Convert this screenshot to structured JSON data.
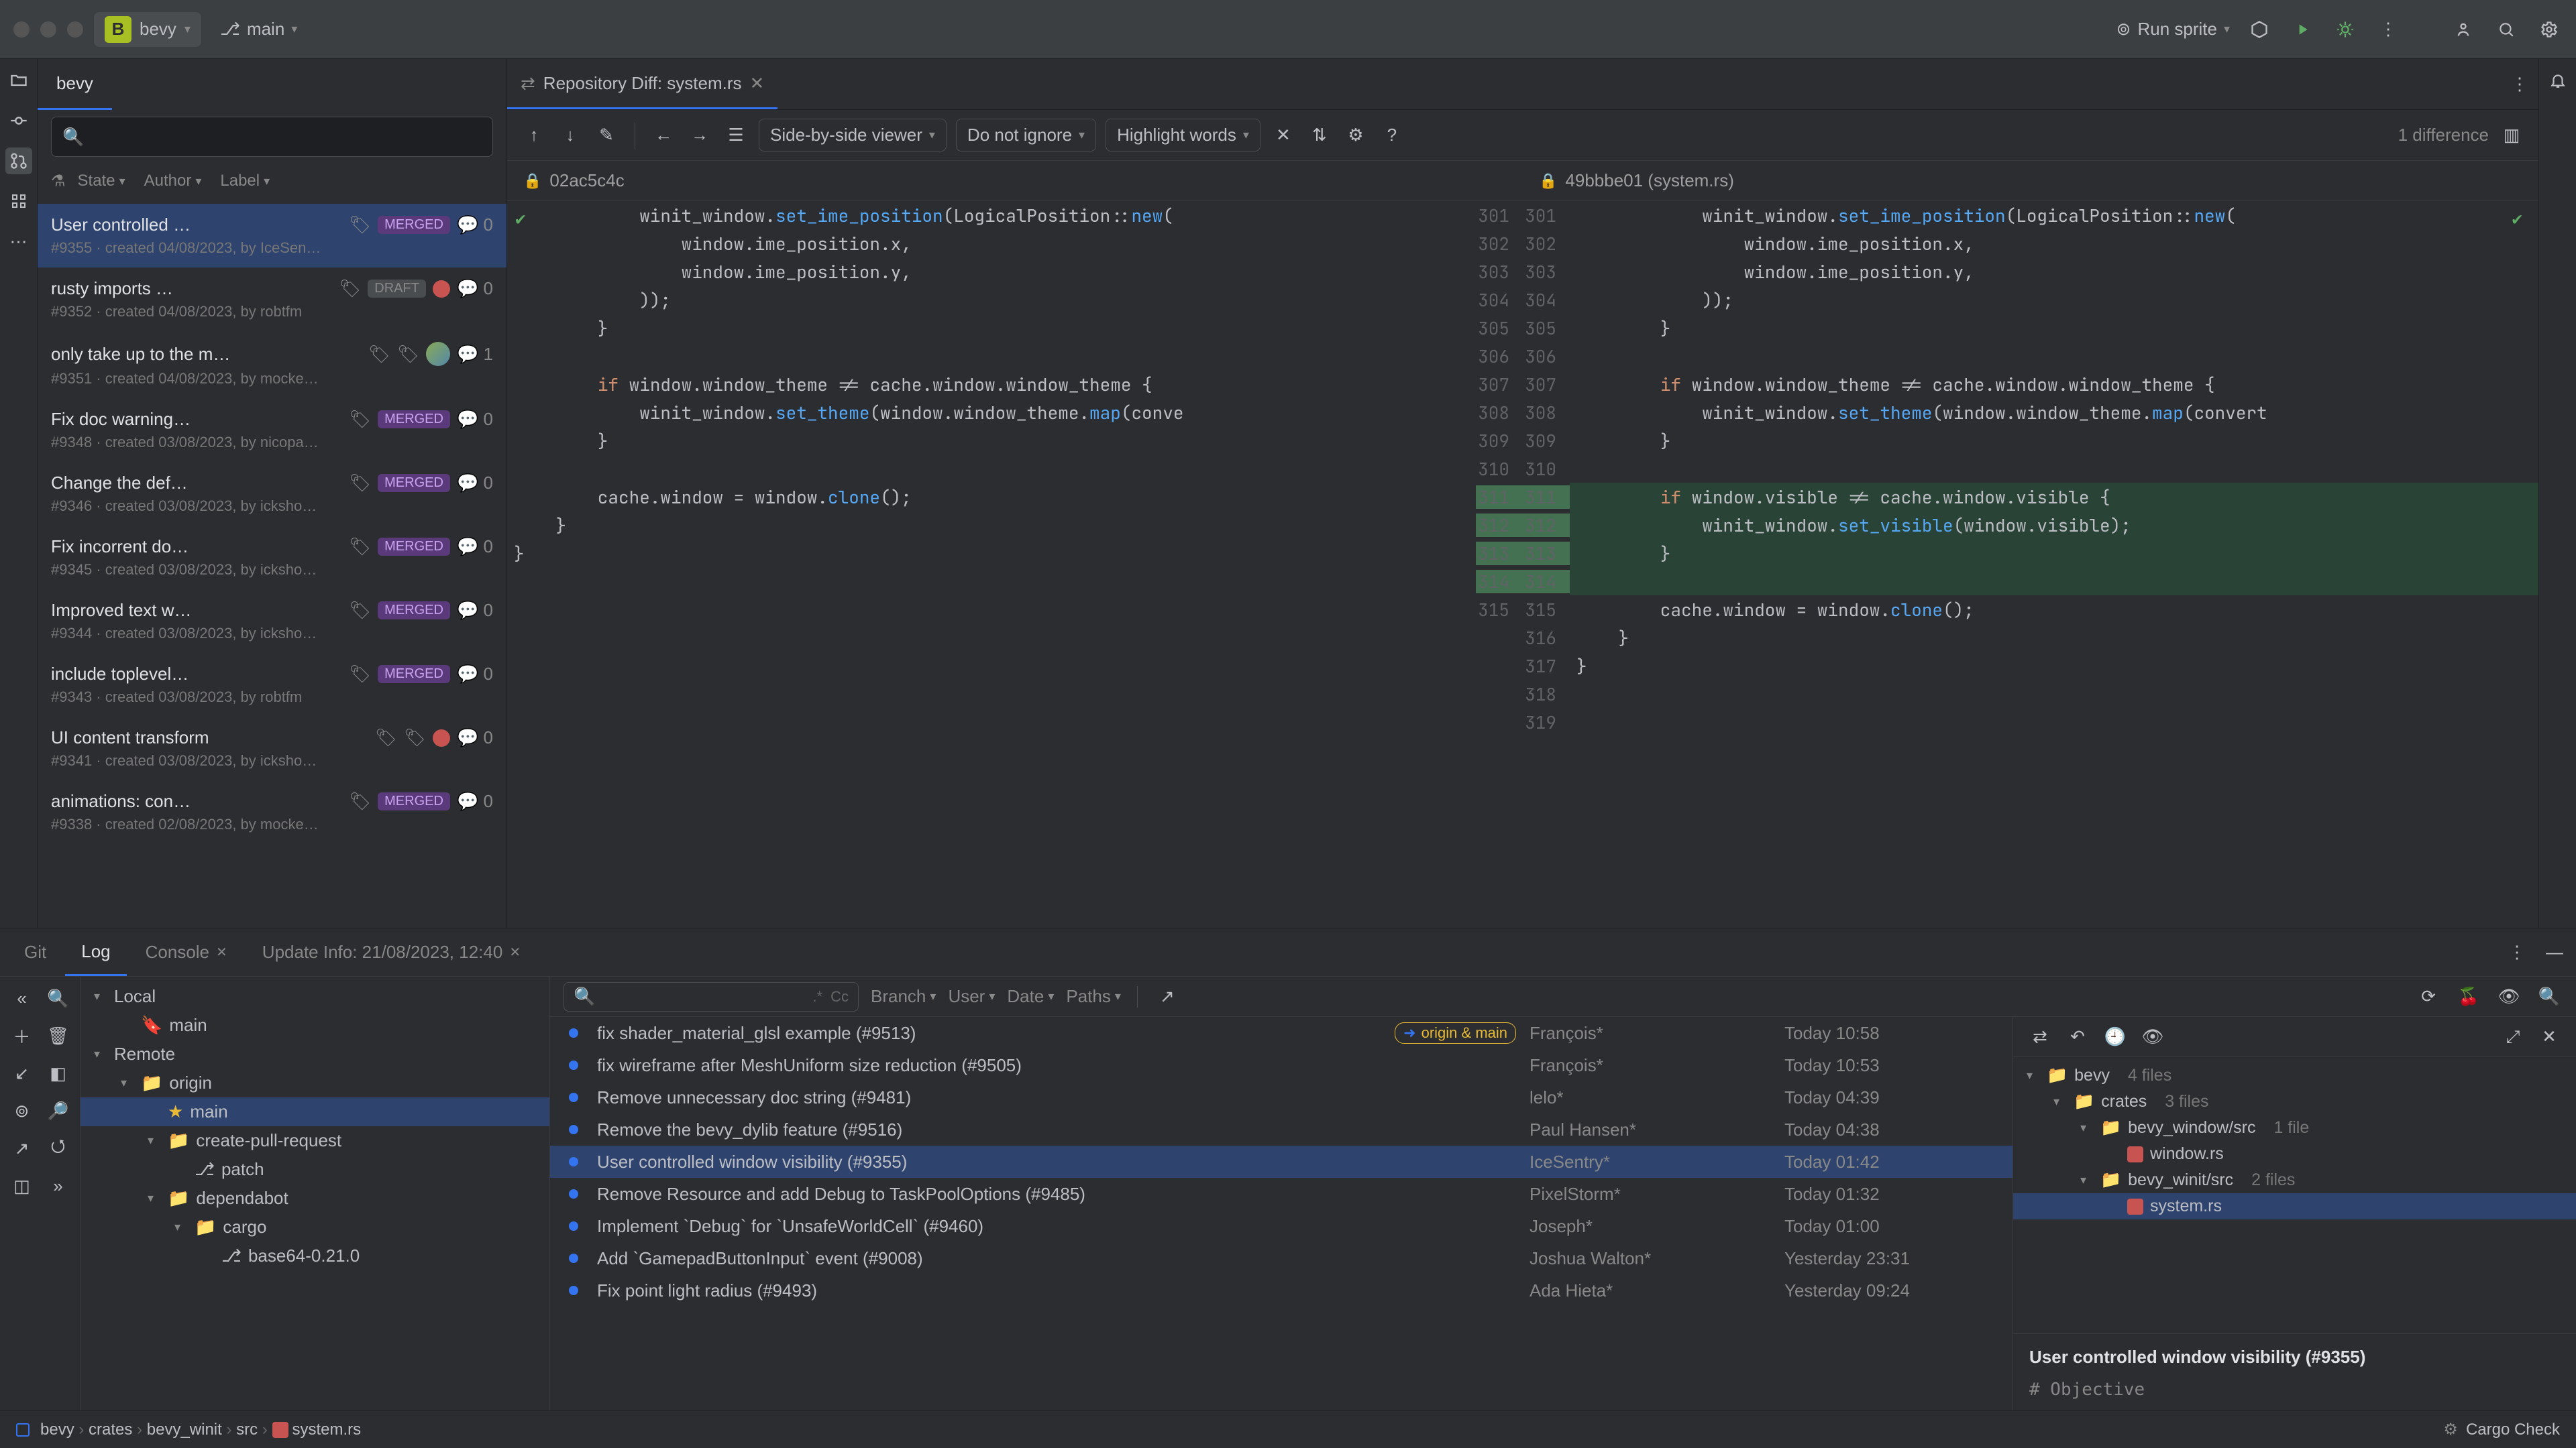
{
  "titlebar": {
    "project_letter": "B",
    "project": "bevy",
    "branch": "main",
    "run_config": "Run sprite"
  },
  "pr_panel": {
    "tab": "bevy",
    "filters": {
      "state": "State",
      "author": "Author",
      "label": "Label"
    },
    "items": [
      {
        "title": "User controlled …",
        "badge": "MERGED",
        "comments": "0",
        "meta": "#9355 · created 04/08/2023, by IceSen…",
        "draft": false,
        "fail": false,
        "avatar": false,
        "sel": true
      },
      {
        "title": "rusty imports …",
        "badge": "DRAFT",
        "comments": "0",
        "meta": "#9352 · created 04/08/2023, by robtfm",
        "draft": true,
        "fail": true,
        "avatar": false
      },
      {
        "title": "only take up to the m…",
        "badge": "",
        "comments": "1",
        "meta": "#9351 · created 04/08/2023, by mocke…",
        "draft": false,
        "fail": false,
        "avatar": true
      },
      {
        "title": "Fix doc warning…",
        "badge": "MERGED",
        "comments": "0",
        "meta": "#9348 · created 03/08/2023, by nicopa…",
        "draft": false,
        "fail": false,
        "avatar": false
      },
      {
        "title": "Change the def…",
        "badge": "MERGED",
        "comments": "0",
        "meta": "#9346 · created 03/08/2023, by icksho…",
        "draft": false,
        "fail": false,
        "avatar": false
      },
      {
        "title": "Fix incorrent do…",
        "badge": "MERGED",
        "comments": "0",
        "meta": "#9345 · created 03/08/2023, by icksho…",
        "draft": false,
        "fail": false,
        "avatar": false
      },
      {
        "title": "Improved text w…",
        "badge": "MERGED",
        "comments": "0",
        "meta": "#9344 · created 03/08/2023, by icksho…",
        "draft": false,
        "fail": false,
        "avatar": false
      },
      {
        "title": "include toplevel…",
        "badge": "MERGED",
        "comments": "0",
        "meta": "#9343 · created 03/08/2023, by robtfm",
        "draft": false,
        "fail": false,
        "avatar": false
      },
      {
        "title": "UI content transform",
        "badge": "",
        "comments": "0",
        "meta": "#9341 · created 03/08/2023, by icksho…",
        "draft": false,
        "fail": true,
        "avatar": false
      },
      {
        "title": "animations: con…",
        "badge": "MERGED",
        "comments": "0",
        "meta": "#9338 · created 02/08/2023, by mocke…",
        "draft": false,
        "fail": false,
        "avatar": false
      }
    ]
  },
  "editor": {
    "tab_label": "Repository Diff: system.rs",
    "diff_toolbar": {
      "viewer_mode": "Side-by-side viewer",
      "whitespace": "Do not ignore",
      "highlight": "Highlight words",
      "summary": "1 difference"
    },
    "left_rev": "02ac5c4c",
    "right_rev": "49bbbe01 (system.rs)",
    "left_lines": [
      {
        "n": "",
        "text": "            winit_window.set_ime_position(LogicalPosition::new("
      },
      {
        "n": "",
        "text": "                window.ime_position.x,"
      },
      {
        "n": "",
        "text": "                window.ime_position.y,"
      },
      {
        "n": "",
        "text": "            ));"
      },
      {
        "n": "",
        "text": "        }"
      },
      {
        "n": "",
        "text": ""
      },
      {
        "n": "",
        "text": "        if window.window_theme != cache.window.window_theme {"
      },
      {
        "n": "",
        "text": "            winit_window.set_theme(window.window_theme.map(conve"
      },
      {
        "n": "",
        "text": "        }"
      },
      {
        "n": "",
        "text": ""
      },
      {
        "n": "",
        "text": "        cache.window = window.clone();"
      },
      {
        "n": "",
        "text": "    }"
      },
      {
        "n": "",
        "text": "}"
      },
      {
        "n": "",
        "text": ""
      },
      {
        "n": "",
        "text": ""
      }
    ],
    "left_nums": [
      "",
      "",
      "",
      "",
      "",
      "",
      "",
      "",
      "",
      "",
      "",
      "",
      "",
      "",
      ""
    ],
    "gutter_left": [
      "301",
      "302",
      "303",
      "304",
      "305",
      "306",
      "307",
      "308",
      "309",
      "310",
      "311",
      "312",
      "313",
      "314",
      "315"
    ],
    "gutter_right": [
      "301",
      "302",
      "303",
      "304",
      "305",
      "306",
      "307",
      "308",
      "309",
      "310",
      "311",
      "312",
      "313",
      "314",
      "315",
      "316",
      "317",
      "318",
      "319"
    ],
    "right_lines": [
      {
        "n": "301",
        "text": "            winit_window.set_ime_position(LogicalPosition::new(",
        "add": false
      },
      {
        "n": "302",
        "text": "                window.ime_position.x,",
        "add": false
      },
      {
        "n": "303",
        "text": "                window.ime_position.y,",
        "add": false
      },
      {
        "n": "304",
        "text": "            ));",
        "add": false
      },
      {
        "n": "305",
        "text": "        }",
        "add": false
      },
      {
        "n": "306",
        "text": "",
        "add": false
      },
      {
        "n": "307",
        "text": "        if window.window_theme != cache.window.window_theme {",
        "add": false
      },
      {
        "n": "308",
        "text": "            winit_window.set_theme(window.window_theme.map(convert",
        "add": false
      },
      {
        "n": "309",
        "text": "        }",
        "add": false
      },
      {
        "n": "310",
        "text": "",
        "add": false
      },
      {
        "n": "311",
        "text": "        if window.visible != cache.window.visible {",
        "add": true
      },
      {
        "n": "312",
        "text": "            winit_window.set_visible(window.visible);",
        "add": true
      },
      {
        "n": "313",
        "text": "        }",
        "add": true
      },
      {
        "n": "314",
        "text": "",
        "add": true
      },
      {
        "n": "315",
        "text": "        cache.window = window.clone();",
        "add": false
      },
      {
        "n": "316",
        "text": "    }",
        "add": false
      },
      {
        "n": "317",
        "text": "}",
        "add": false
      },
      {
        "n": "318",
        "text": "",
        "add": false
      },
      {
        "n": "319",
        "text": "",
        "add": false
      }
    ]
  },
  "bottom": {
    "tabs": {
      "git": "Git",
      "log": "Log",
      "console": "Console",
      "update": "Update Info: 21/08/2023, 12:40"
    },
    "filters": {
      "branch": "Branch",
      "user": "User",
      "date": "Date",
      "paths": "Paths",
      "regex": ".*",
      "cc": "Cc"
    },
    "branches": {
      "local": "Local",
      "local_main": "main",
      "remote": "Remote",
      "origin": "origin",
      "origin_main": "main",
      "cpr": "create-pull-request",
      "patch": "patch",
      "dependabot": "dependabot",
      "cargo": "cargo",
      "base64": "base64-0.21.0"
    },
    "commits": [
      {
        "subject": "fix shader_material_glsl example (#9513)",
        "author": "François*",
        "date": "Today 10:58",
        "tag": "origin & main",
        "sel": false
      },
      {
        "subject": "fix wireframe after MeshUniform size reduction (#9505)",
        "author": "François*",
        "date": "Today 10:53",
        "sel": false
      },
      {
        "subject": "Remove unnecessary doc string (#9481)",
        "author": "lelo*",
        "date": "Today 04:39",
        "sel": false
      },
      {
        "subject": "Remove the bevy_dylib feature (#9516)",
        "author": "Paul Hansen*",
        "date": "Today 04:38",
        "sel": false
      },
      {
        "subject": "User controlled window visibility (#9355)",
        "author": "IceSentry*",
        "date": "Today 01:42",
        "sel": true
      },
      {
        "subject": "Remove Resource and add Debug to TaskPoolOptions (#9485)",
        "author": "PixelStorm*",
        "date": "Today 01:32",
        "sel": false
      },
      {
        "subject": "Implement `Debug` for `UnsafeWorldCell` (#9460)",
        "author": "Joseph*",
        "date": "Today 01:00",
        "sel": false
      },
      {
        "subject": "Add `GamepadButtonInput` event (#9008)",
        "author": "Joshua Walton*",
        "date": "Yesterday 23:31",
        "sel": false
      },
      {
        "subject": "Fix point light radius (#9493)",
        "author": "Ada Hieta*",
        "date": "Yesterday 09:24",
        "sel": false
      }
    ],
    "detail": {
      "root": "bevy",
      "root_ct": "4 files",
      "crates": "crates",
      "crates_ct": "3 files",
      "bwin": "bevy_window/src",
      "bwin_ct": "1 file",
      "window_rs": "window.rs",
      "bwinit": "bevy_winit/src",
      "bwinit_ct": "2 files",
      "system_rs": "system.rs",
      "commit_title": "User controlled window visibility (#9355)",
      "objective": "# Objective"
    }
  },
  "status": {
    "crumbs": [
      "bevy",
      "crates",
      "bevy_winit",
      "src",
      "system.rs"
    ],
    "cargo": "Cargo Check"
  }
}
